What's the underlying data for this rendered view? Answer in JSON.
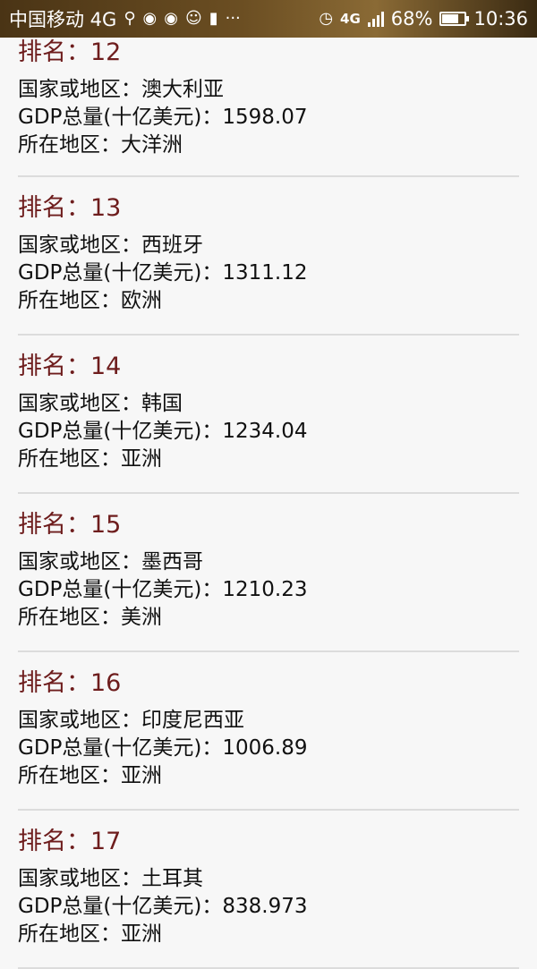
{
  "status_bar": {
    "carrier": "中国移动 4G",
    "battery_percent": "68%",
    "battery_level": 0.68,
    "time": "10:36",
    "network": "4G",
    "more": "···"
  },
  "labels": {
    "rank": "排名：",
    "country": "国家或地区：",
    "gdp": "GDP总量(十亿美元)：",
    "region": "所在地区："
  },
  "items": [
    {
      "rank": "12",
      "country": "澳大利亚",
      "gdp": "1598.07",
      "region": "大洋洲"
    },
    {
      "rank": "13",
      "country": "西班牙",
      "gdp": "1311.12",
      "region": "欧洲"
    },
    {
      "rank": "14",
      "country": "韩国",
      "gdp": "1234.04",
      "region": "亚洲"
    },
    {
      "rank": "15",
      "country": "墨西哥",
      "gdp": "1210.23",
      "region": "美洲"
    },
    {
      "rank": "16",
      "country": "印度尼西亚",
      "gdp": "1006.89",
      "region": "亚洲"
    },
    {
      "rank": "17",
      "country": "土耳其",
      "gdp": "838.973",
      "region": "亚洲"
    }
  ]
}
